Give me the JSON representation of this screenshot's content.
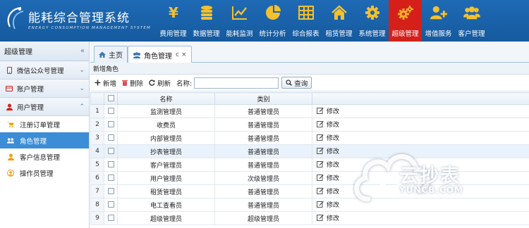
{
  "app": {
    "title": "能耗综合管理系统",
    "subtitle": "ENERGY CONSUMPTION MANAGEMENT SYSTEM"
  },
  "nav": [
    {
      "label": "费用管理",
      "icon": "yen-icon"
    },
    {
      "label": "数据管理",
      "icon": "database-icon"
    },
    {
      "label": "能耗监测",
      "icon": "line-chart-icon"
    },
    {
      "label": "统计分析",
      "icon": "pie-chart-icon"
    },
    {
      "label": "综合报表",
      "icon": "table-icon"
    },
    {
      "label": "租赁管理",
      "icon": "home-icon"
    },
    {
      "label": "系统管理",
      "icon": "gear-icon"
    },
    {
      "label": "超级管理",
      "icon": "gears-icon",
      "active": true
    },
    {
      "label": "增值服务",
      "icon": "user-plus-icon"
    },
    {
      "label": "客户管理",
      "icon": "users-icon"
    }
  ],
  "sidebar": {
    "title": "超级管理",
    "groups": [
      {
        "label": "微信公众号管理",
        "icon": "mobile-icon"
      },
      {
        "label": "账户管理",
        "icon": "card-icon"
      },
      {
        "label": "用户管理",
        "icon": "user-icon"
      }
    ],
    "items": [
      {
        "label": "注册订单管理",
        "icon": "cart-icon"
      },
      {
        "label": "角色管理",
        "icon": "users-icon",
        "active": true
      },
      {
        "label": "客户信息管理",
        "icon": "user-icon"
      },
      {
        "label": "操作员管理",
        "icon": "user-circle-icon"
      }
    ]
  },
  "tabs": {
    "home": "主页",
    "roles": "角色管理",
    "refresh_glyph": "c",
    "close_glyph": "×"
  },
  "section": {
    "title": "新增角色"
  },
  "toolbar": {
    "add": "新增",
    "delete": "删除",
    "refresh": "刷新",
    "name_label": "名称:",
    "search_value": "",
    "search": "查询"
  },
  "table": {
    "columns": [
      "名称",
      "类别"
    ],
    "edit_label": "修改",
    "rows": [
      {
        "no": "1",
        "name": "监测管理员",
        "type": "普通管理员"
      },
      {
        "no": "2",
        "name": "收费员",
        "type": "普通管理员"
      },
      {
        "no": "3",
        "name": "内部管理员",
        "type": "普通管理员"
      },
      {
        "no": "4",
        "name": "抄表管理员",
        "type": "普通管理员",
        "highlight": true
      },
      {
        "no": "5",
        "name": "客户管理员",
        "type": "普通管理员"
      },
      {
        "no": "6",
        "name": "用户管理员",
        "type": "次级管理员"
      },
      {
        "no": "7",
        "name": "租赁管理员",
        "type": "普通管理员"
      },
      {
        "no": "8",
        "name": "电工查看员",
        "type": "普通管理员"
      },
      {
        "no": "9",
        "name": "超级管理员",
        "type": "超级管理员"
      }
    ]
  },
  "watermark": {
    "text": "云抄表",
    "url": "YUNCB.COM"
  },
  "colors": {
    "header": "#1a62ab",
    "nav_active": "#d5201a",
    "sidebar_active": "#3c8dd6"
  }
}
